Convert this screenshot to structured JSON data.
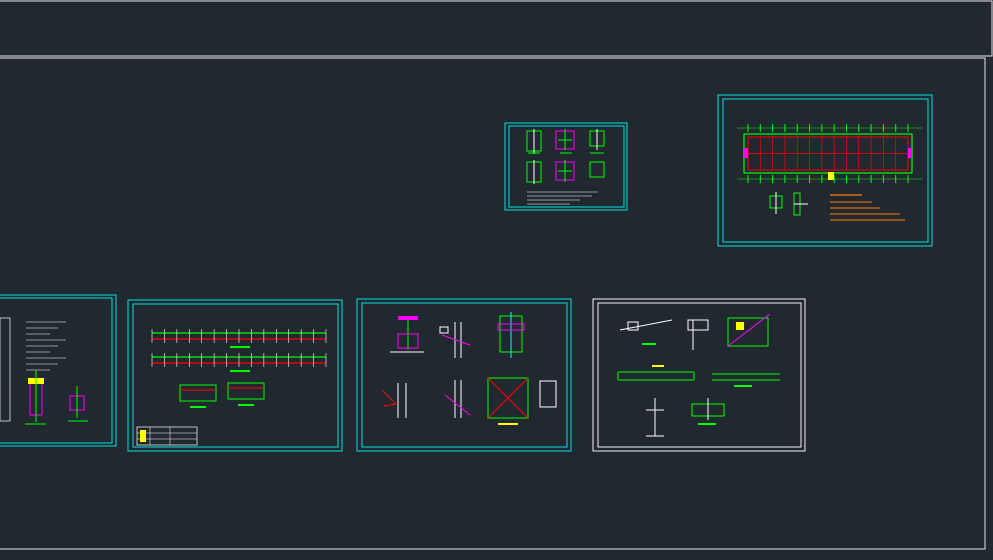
{
  "viewport": {
    "background": "#212830"
  },
  "colors": {
    "frame": "#e6e6e6",
    "sheet_border": "#00e5e5",
    "white_frame": "#f2f2f2",
    "green": "#00ff00",
    "red": "#ff0000",
    "yellow": "#ffff00",
    "magenta": "#ff00ff",
    "cyan": "#00ffff",
    "orange": "#ff7f00",
    "white": "#ffffff"
  },
  "drawing": {
    "sheets": [
      {
        "id": "node-details-small",
        "name": "sheet-node-details-small"
      },
      {
        "id": "roof-plan",
        "name": "sheet-roof-plan"
      },
      {
        "id": "general-notes",
        "name": "sheet-general-notes"
      },
      {
        "id": "purlin-layout",
        "name": "sheet-purlin-layout"
      },
      {
        "id": "connection-details",
        "name": "sheet-connection-details"
      },
      {
        "id": "truss-details",
        "name": "sheet-truss-details"
      }
    ]
  }
}
